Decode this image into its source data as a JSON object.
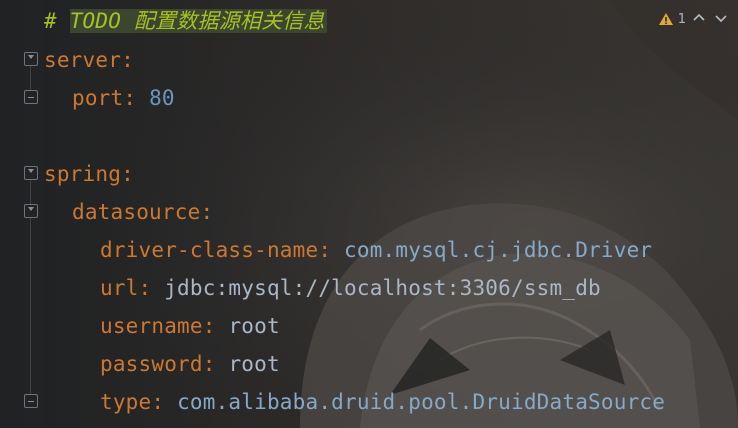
{
  "colors": {
    "editor_bg": "#26282a",
    "key": "#cc7832",
    "number": "#6897bb",
    "string_value": "#a9b7c6",
    "class_value": "#87a9c7",
    "todo": "#a8c023",
    "todo_bg": "#3b4530"
  },
  "inspection": {
    "icon": "warning-triangle-icon",
    "count": "1",
    "prev_icon": "chevron-up-icon",
    "next_icon": "chevron-down-icon"
  },
  "code": {
    "comment": {
      "hash": "#",
      "todo": "TODO",
      "text": "配置数据源相关信息"
    },
    "server": {
      "key": "server",
      "port": {
        "key": "port",
        "value": "80"
      }
    },
    "spring": {
      "key": "spring",
      "datasource": {
        "key": "datasource",
        "driver_class_name": {
          "key": "driver-class-name",
          "value": "com.mysql.cj.jdbc.Driver"
        },
        "url": {
          "key": "url",
          "value": "jdbc:mysql://localhost:3306/ssm_db"
        },
        "username": {
          "key": "username",
          "value": "root"
        },
        "password": {
          "key": "password",
          "value": "root"
        },
        "type": {
          "key": "type",
          "value": "com.alibaba.druid.pool.DruidDataSource"
        }
      }
    }
  }
}
